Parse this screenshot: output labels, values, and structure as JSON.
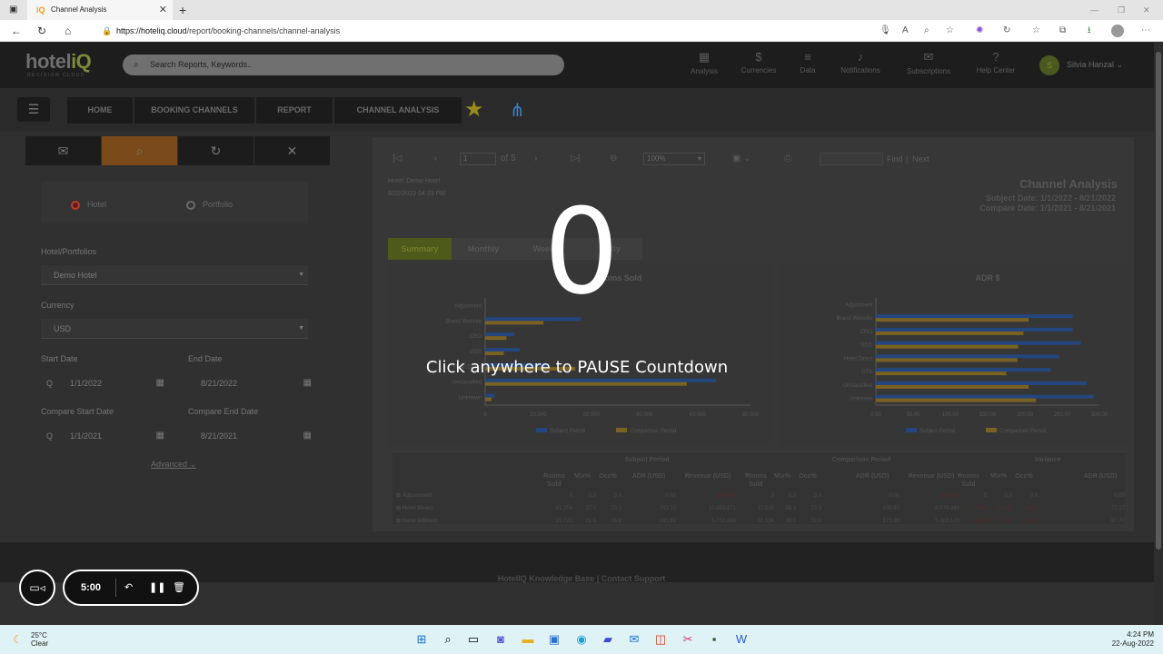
{
  "browser": {
    "tab_title": "Channel Analysis",
    "tab_favicon": "iQ",
    "url_host": "https://hoteliq.cloud",
    "url_path": "/report/booking-channels/channel-analysis"
  },
  "app": {
    "logo_main": "hotel",
    "logo_accent": "iQ",
    "logo_sub": "DECISION CLOUD",
    "search_placeholder": "Search Reports, Keywords..",
    "nav": [
      {
        "label": "Analysis",
        "icon": "grid-icon"
      },
      {
        "label": "Currencies",
        "icon": "currency-icon"
      },
      {
        "label": "Data",
        "icon": "database-icon"
      },
      {
        "label": "Notifications",
        "icon": "bell-icon"
      },
      {
        "label": "Subscriptions",
        "icon": "mail-icon"
      },
      {
        "label": "Help Center",
        "icon": "help-icon"
      }
    ],
    "user_initial": "S",
    "user_name": "Silvia Hanzal",
    "breadcrumbs": [
      "HOME",
      "BOOKING CHANNELS",
      "REPORT",
      "CHANNEL ANALYSIS"
    ]
  },
  "filters": {
    "radio_hotel": "Hotel",
    "radio_portfolio": "Portfolio",
    "hotel_label": "Hotel/Portfolios",
    "hotel_value": "Demo Hotel",
    "currency_label": "Currency",
    "currency_value": "USD",
    "start_label": "Start Date",
    "start_value": "1/1/2022",
    "end_label": "End Date",
    "end_value": "8/21/2022",
    "cstart_label": "Compare Start Date",
    "cstart_value": "1/1/2021",
    "cend_label": "Compare End Date",
    "cend_value": "8/21/2021",
    "advanced": "Advanced"
  },
  "report": {
    "page": "1",
    "of_pages": "of 5",
    "zoom": "100%",
    "find": "Find",
    "next": "Next",
    "hotel_line": "Hotel: Demo Hotel",
    "date_line": "8/22/2022 04:23 PM",
    "title": "Channel Analysis",
    "subject_date": "Subject Date: 1/1/2022 - 8/21/2022",
    "compare_date": "Compare Date: 1/1/2021 - 8/21/2021",
    "tabs": [
      "Summary",
      "Monthly",
      "Weekly",
      "Daily"
    ],
    "legend_subject": "Subject Period",
    "legend_compare": "Comparison Period"
  },
  "chart_data": [
    {
      "type": "bar",
      "title": "Rooms Sold",
      "categories": [
        "Adjustment",
        "Brand Website",
        "CRO",
        "GDS",
        "Hotel Direct",
        "Unclassified",
        "Unknown"
      ],
      "series": [
        {
          "name": "Subject Period",
          "values": [
            0,
            18000,
            5500,
            6500,
            12000,
            43500,
            1800
          ]
        },
        {
          "name": "Comparison Period",
          "values": [
            0,
            11000,
            4000,
            3500,
            17000,
            38000,
            1200
          ]
        }
      ],
      "xticks": [
        "0",
        "10,000",
        "20,000",
        "30,000",
        "40,000",
        "50,000"
      ],
      "xlim": [
        0,
        50000
      ]
    },
    {
      "type": "bar",
      "title": "ADR $",
      "categories": [
        "Adjustment",
        "Brand Website",
        "CRO",
        "GDS",
        "Hotel Direct",
        "OTA",
        "Unclassified",
        "Unknown"
      ],
      "series": [
        {
          "name": "Subject Period",
          "values": [
            0,
            264,
            264,
            275,
            246,
            235,
            283,
            292
          ]
        },
        {
          "name": "Comparison Period",
          "values": [
            0,
            205,
            198,
            191,
            190,
            175,
            205,
            215
          ]
        }
      ],
      "xticks": [
        "0.00",
        "50.00",
        "100.00",
        "150.00",
        "200.00",
        "250.00",
        "300.00"
      ],
      "xlim": [
        0,
        300
      ]
    }
  ],
  "table": {
    "group_subject": "Subject Period",
    "group_compare": "Comparison Period",
    "group_variance": "Variance",
    "headers": [
      "Rooms Sold",
      "Mix%",
      "Occ%",
      "ADR (USD)",
      "Revenue (USD)",
      "Rooms Sold",
      "Mix%",
      "Occ%",
      "ADR (USD)",
      "Revenue (USD)",
      "Rooms Sold",
      "Mix%",
      "Occ%",
      "ADR (USD)"
    ],
    "rows": [
      {
        "name": "Adjustment",
        "cells": [
          "0",
          "0.0",
          "0.0",
          "0.00",
          "(24,461)",
          "0",
          "0.0",
          "0.0",
          "0.00",
          "(16,642)",
          "0",
          "0.0",
          "0.0",
          "0.00"
        ]
      },
      {
        "name": "Hotel Direct",
        "cells": [
          "41,254",
          "37.5",
          "29.2",
          "263.10",
          "10,853,871",
          "47,028",
          "58.3",
          "33.3",
          "190.93",
          "8,978,884",
          "(5,774)",
          "(20.9)",
          "(4.1)",
          "72.17"
        ]
      },
      {
        "name": "Hotel InDirect",
        "cells": [
          "23,721",
          "21.5",
          "16.8",
          "241.65",
          "5,732,656",
          "31,534",
          "39.1",
          "22.3",
          "173.88",
          "5,483,178",
          "(7,813)",
          "(17.6)",
          "(5.5)",
          "67.77"
        ]
      }
    ]
  },
  "footer": "HotelIQ Knowledge Base | Contact Support",
  "overlay": {
    "countdown": "0",
    "message": "Click anywhere to PAUSE Countdown",
    "timer": "5:00"
  },
  "taskbar": {
    "temp": "25°C",
    "condition": "Clear",
    "time": "4:24 PM",
    "date": "22-Aug-2022"
  },
  "colors": {
    "subject": "#2a5aa8",
    "comparison": "#b08a2a",
    "accent": "#7d8a3a"
  }
}
